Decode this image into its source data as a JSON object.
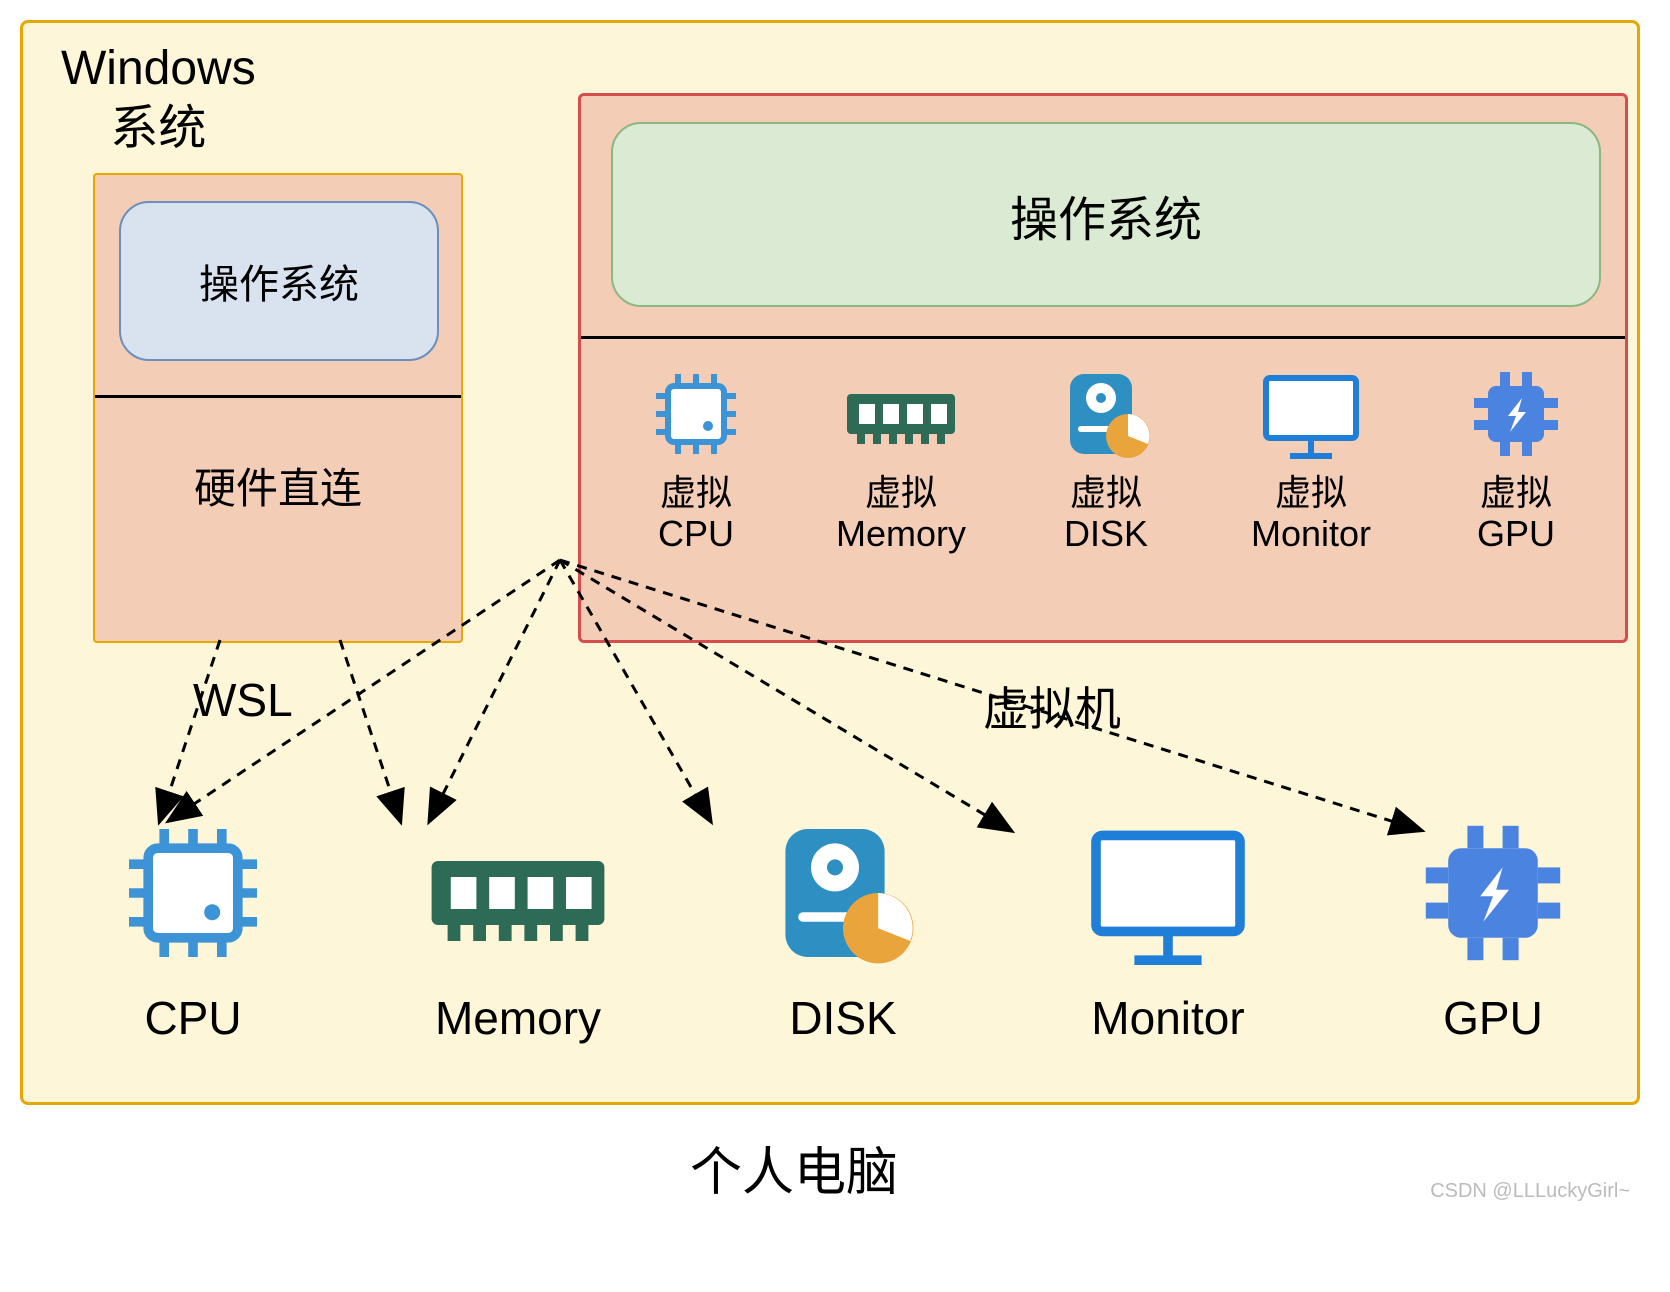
{
  "outer": {
    "title_line1": "Windows",
    "title_line2": "系统"
  },
  "wsl": {
    "os_label": "操作系统",
    "hw_label": "硬件直连",
    "label": "WSL"
  },
  "vm": {
    "os_label": "操作系统",
    "label": "虚拟机",
    "items": [
      {
        "line1": "虚拟",
        "line2": "CPU",
        "icon": "cpu"
      },
      {
        "line1": "虚拟",
        "line2": "Memory",
        "icon": "memory"
      },
      {
        "line1": "虚拟",
        "line2": "DISK",
        "icon": "disk"
      },
      {
        "line1": "虚拟",
        "line2": "Monitor",
        "icon": "monitor"
      },
      {
        "line1": "虚拟",
        "line2": "GPU",
        "icon": "gpu"
      }
    ]
  },
  "pc": {
    "title": "个人电脑",
    "items": [
      {
        "label": "CPU",
        "icon": "cpu"
      },
      {
        "label": "Memory",
        "icon": "memory"
      },
      {
        "label": "DISK",
        "icon": "disk"
      },
      {
        "label": "Monitor",
        "icon": "monitor"
      },
      {
        "label": "GPU",
        "icon": "gpu"
      }
    ]
  },
  "watermark": "CSDN @LLLuckyGirl~",
  "colors": {
    "outer_bg": "#fdf6d8",
    "outer_border": "#e6a800",
    "wsl_bg": "#f4cdb7",
    "wsl_os_bg": "#d9e3f0",
    "vm_border": "#d54d4d",
    "vm_os_bg": "#dbebd3",
    "cpu_blue": "#3c93d6",
    "mem_green": "#2d6b56",
    "disk_blue": "#2e8fc3",
    "disk_orange": "#e9a43b",
    "monitor_blue": "#1f7ed8",
    "gpu_blue": "#4a84e0"
  }
}
